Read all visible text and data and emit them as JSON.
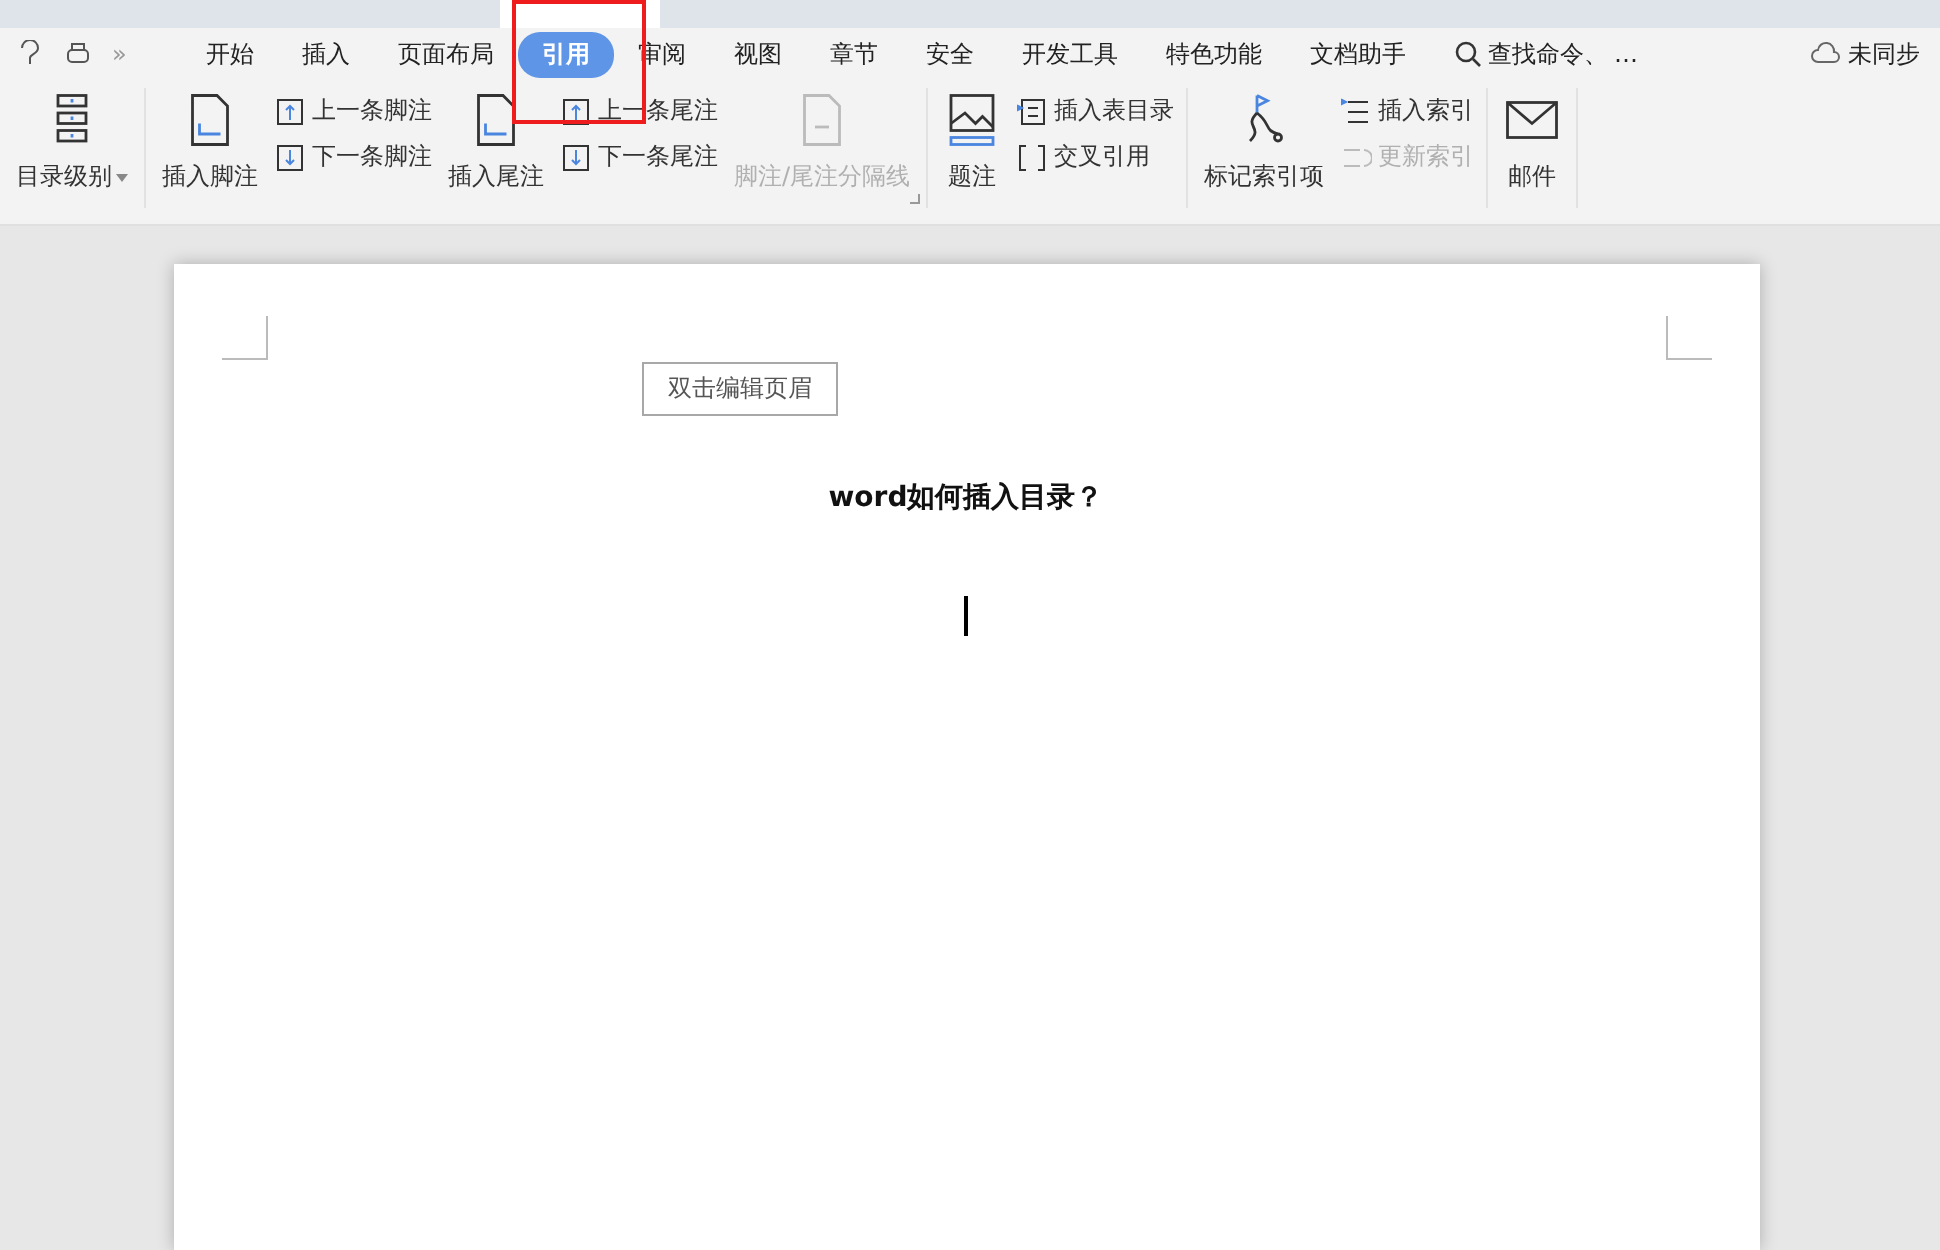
{
  "tabs": [
    {
      "label": "开始",
      "selected": false
    },
    {
      "label": "插入",
      "selected": false
    },
    {
      "label": "页面布局",
      "selected": false
    },
    {
      "label": "引用",
      "selected": true
    },
    {
      "label": "审阅",
      "selected": false
    },
    {
      "label": "视图",
      "selected": false
    },
    {
      "label": "章节",
      "selected": false
    },
    {
      "label": "安全",
      "selected": false
    },
    {
      "label": "开发工具",
      "selected": false
    },
    {
      "label": "特色功能",
      "selected": false
    },
    {
      "label": "文档助手",
      "selected": false
    }
  ],
  "quick_access": {
    "more": "»"
  },
  "search": {
    "placeholder": "查找命令、",
    "more": "…"
  },
  "sync": {
    "label": "未同步"
  },
  "ribbon": {
    "groups": [
      {
        "items": [
          {
            "kind": "large",
            "label": "目录级别",
            "dropdown": true,
            "disabled": false
          }
        ]
      },
      {
        "launcher": true,
        "items": [
          {
            "kind": "large",
            "label": "插入脚注",
            "disabled": false
          },
          {
            "kind": "stack",
            "items": [
              {
                "label": "上一条脚注",
                "disabled": false
              },
              {
                "label": "下一条脚注",
                "disabled": false
              }
            ]
          },
          {
            "kind": "large",
            "label": "插入尾注",
            "disabled": false
          },
          {
            "kind": "stack",
            "items": [
              {
                "label": "上一条尾注",
                "disabled": false
              },
              {
                "label": "下一条尾注",
                "disabled": false
              }
            ]
          },
          {
            "kind": "large",
            "label": "脚注/尾注分隔线",
            "disabled": true
          }
        ]
      },
      {
        "items": [
          {
            "kind": "large",
            "label": "题注",
            "disabled": false
          },
          {
            "kind": "stack",
            "items": [
              {
                "label": "插入表目录",
                "disabled": false
              },
              {
                "label": "交叉引用",
                "disabled": false
              }
            ]
          }
        ]
      },
      {
        "items": [
          {
            "kind": "large",
            "label": "标记索引项",
            "disabled": false
          },
          {
            "kind": "stack",
            "items": [
              {
                "label": "插入索引",
                "disabled": false
              },
              {
                "label": "更新索引",
                "disabled": true
              }
            ]
          }
        ]
      },
      {
        "items": [
          {
            "kind": "large",
            "label": "邮件",
            "disabled": false
          }
        ]
      }
    ]
  },
  "document": {
    "header_hint": "双击编辑页眉",
    "title": "word如何插入目录？"
  }
}
